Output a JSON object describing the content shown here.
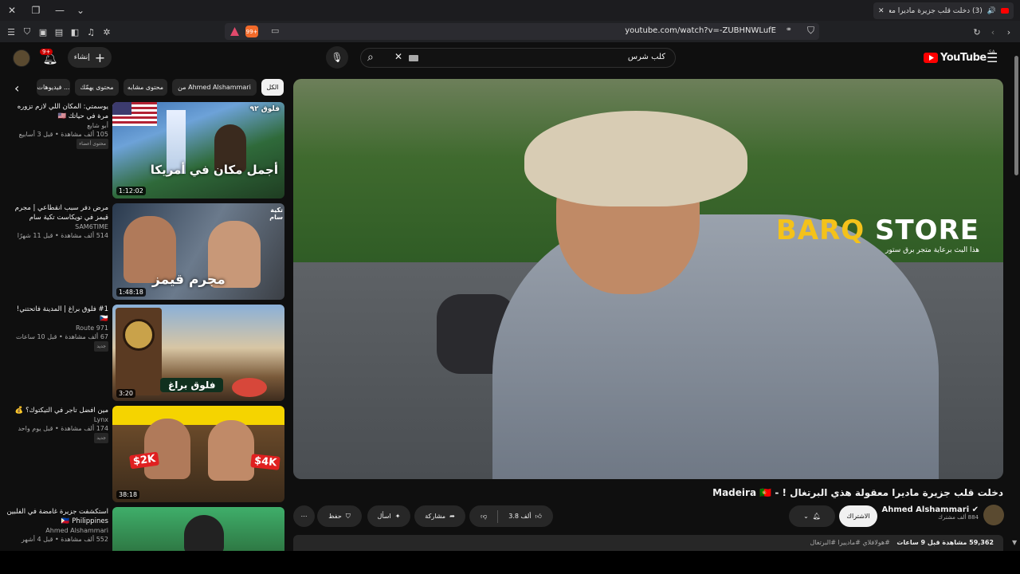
{
  "browser": {
    "tab_title": "(3) دخلت قلب جزيرة ماديرا معقـ",
    "url": "youtube.com/watch?v=-ZUBHNWLufE"
  },
  "header": {
    "logo_text": "YouTube",
    "region": "SA",
    "search_value": "كلب شرس",
    "create_label": "إنشاء",
    "notifications_count": "9+"
  },
  "chips": [
    "الكل",
    "من Ahmed Alshammari",
    "محتوى مشابه",
    "محتوى يهمّك",
    "فيديوهات ..."
  ],
  "sidebar": {
    "items": [
      {
        "title": "يوسمتي: المكان اللي لازم تزوره مرة في حياتك 🇺🇸",
        "channel": "أبو شايع",
        "views": "105 ألف مشاهدة",
        "age": "قبل 3 أسابيع",
        "badge": "محتوى أعضاء",
        "duration": "1:12:02",
        "thumb_caption": "أجمل مكان في أمريكا",
        "thumb_tag": "فلوق ٩٢"
      },
      {
        "title": "مرض دفر سبب انقطاعي | مجرم قيمز في تويكاست تكية سام",
        "channel": "SAM6TIME",
        "views": "514 ألف مشاهدة",
        "age": "قبل 11 شهرًا",
        "badge": "",
        "duration": "1:48:18",
        "thumb_caption": "مجرم قيمز",
        "thumb_tag": "تكية سام"
      },
      {
        "title": "#1 فلوق براغ | المدينة فاتحتني! 🇨🇿",
        "channel": "Route 971",
        "views": "67 ألف مشاهدة",
        "age": "قبل 10 ساعات",
        "badge": "جديد",
        "duration": "3:20",
        "thumb_caption": "فلوق براغ",
        "thumb_tag": ""
      },
      {
        "title": "مين افضل تاجر في التيكتوك؟ 💰",
        "channel": "Lynx",
        "views": "174 ألف مشاهدة",
        "age": "قبل يوم واحد",
        "badge": "جديد",
        "duration": "38:18",
        "thumb_caption": "",
        "thumb_tag": "",
        "price_left": "$2K",
        "price_right": "$4K"
      },
      {
        "title": "استكشفت جزيرة غامضة في الفلبين 🇵🇭 Philippines",
        "channel": "Ahmed Alshammari",
        "views": "552 ألف مشاهدة",
        "age": "قبل 4 أشهر",
        "badge": "",
        "duration": "",
        "thumb_caption": "",
        "thumb_tag": ""
      }
    ]
  },
  "video": {
    "title": "دخلت قلب جزيرة ماديرا معقولة هذي البرتغال ! - Madeira 🇵🇹",
    "sponsor_brand_a": "BARQ",
    "sponsor_brand_b": "STORE",
    "sponsor_line": "هذا البث برعاية متجر برق ستور",
    "channel": "Ahmed Alshammari",
    "subscribers": "884 ألف مشترك",
    "subscribe_label": "الاشتراك",
    "likes": "3.8 ألف",
    "share_label": "مشاركة",
    "ask_label": "اسأل",
    "save_label": "حفظ",
    "views": "59,362 مشاهدة قبل 9 ساعات",
    "hashtags": "#هولافلاي #مادييرا #البرتغال"
  },
  "colors": {
    "accent": "#ff0000",
    "bg": "#0f0f0f",
    "chip": "#272727"
  }
}
